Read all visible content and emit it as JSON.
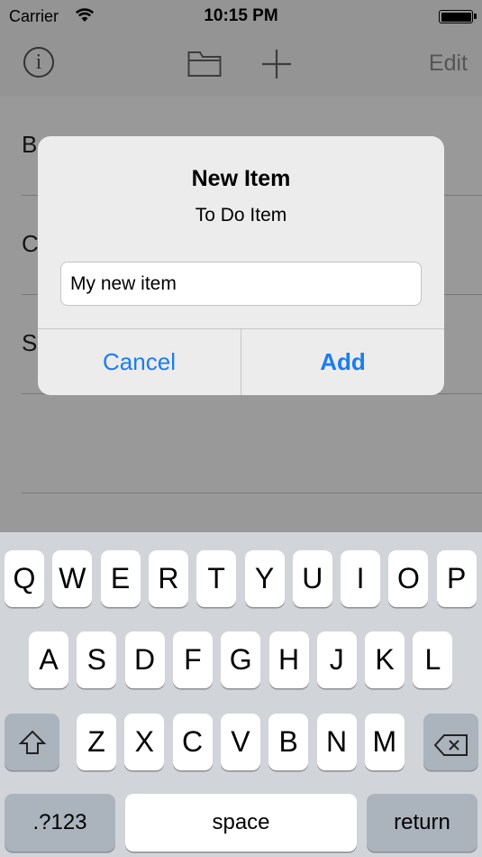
{
  "status_bar": {
    "carrier": "Carrier",
    "time": "10:15 PM"
  },
  "nav": {
    "info_icon": "info-icon",
    "folder_icon": "folder-icon",
    "add_icon": "plus-icon",
    "edit_label": "Edit"
  },
  "list": {
    "rows": [
      {
        "label": "B"
      },
      {
        "label": "C"
      },
      {
        "label": "S"
      },
      {
        "label": ""
      }
    ]
  },
  "alert": {
    "title": "New Item",
    "message": "To Do Item",
    "input_value": "My new item",
    "cancel_label": "Cancel",
    "add_label": "Add"
  },
  "keyboard": {
    "row1": [
      "Q",
      "W",
      "E",
      "R",
      "T",
      "Y",
      "U",
      "I",
      "O",
      "P"
    ],
    "row2": [
      "A",
      "S",
      "D",
      "F",
      "G",
      "H",
      "J",
      "K",
      "L"
    ],
    "row3": [
      "Z",
      "X",
      "C",
      "V",
      "B",
      "N",
      "M"
    ],
    "shift_icon": "shift-icon",
    "delete_icon": "backspace-icon",
    "numbers_label": ".?123",
    "space_label": "space",
    "return_label": "return"
  },
  "colors": {
    "accent": "#1a7cf5",
    "keyboard_bg": "#d1d4d9",
    "key_dark": "#abb3bd"
  }
}
